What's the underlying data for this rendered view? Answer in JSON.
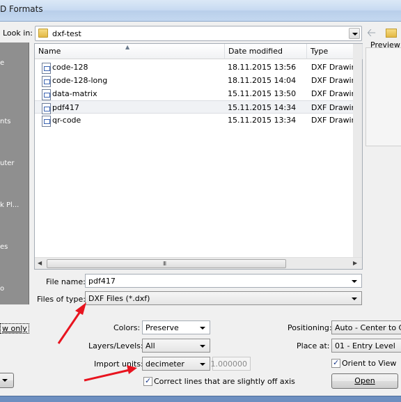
{
  "window": {
    "title": "D Formats"
  },
  "places": {
    "items": [
      "e",
      "nts",
      "uter",
      "k Pl...",
      "es",
      "o"
    ]
  },
  "lookin": {
    "label": "Look in:",
    "value": "dxf-test"
  },
  "preview": {
    "label": "Preview"
  },
  "filelist": {
    "columns": [
      "Name",
      "Date modified",
      "Type"
    ],
    "rows": [
      {
        "name": "code-128",
        "date": "18.11.2015 13:56",
        "type": "DXF Drawing I"
      },
      {
        "name": "code-128-long",
        "date": "18.11.2015 14:04",
        "type": "DXF Drawing I"
      },
      {
        "name": "data-matrix",
        "date": "15.11.2015 13:50",
        "type": "DXF Drawing I"
      },
      {
        "name": "pdf417",
        "date": "15.11.2015 14:34",
        "type": "DXF Drawing I"
      },
      {
        "name": "qr-code",
        "date": "15.11.2015 13:34",
        "type": "DXF Drawing I"
      }
    ],
    "hscroll_grip": "III"
  },
  "filename": {
    "label": "File name:",
    "value": "pdf417"
  },
  "filetype": {
    "label": "Files of type:",
    "value": "DXF Files  (*.dxf)"
  },
  "options": {
    "view_only": "w only",
    "colors_label": "Colors:",
    "colors_value": "Preserve",
    "layers_label": "Layers/Levels:",
    "layers_value": "All",
    "units_label": "Import units:",
    "units_value": "decimeter",
    "units_factor": "1.000000",
    "correct_lines": "Correct lines that are slightly off axis",
    "positioning_label": "Positioning:",
    "positioning_value": "Auto - Center to Cen",
    "placeat_label": "Place at:",
    "placeat_value": "01 - Entry Level",
    "orient_label": "Orient to View",
    "open_label": "Open"
  },
  "colors": {
    "arrow": "#e8141f",
    "bottom_bar": "#6d8fc0"
  }
}
